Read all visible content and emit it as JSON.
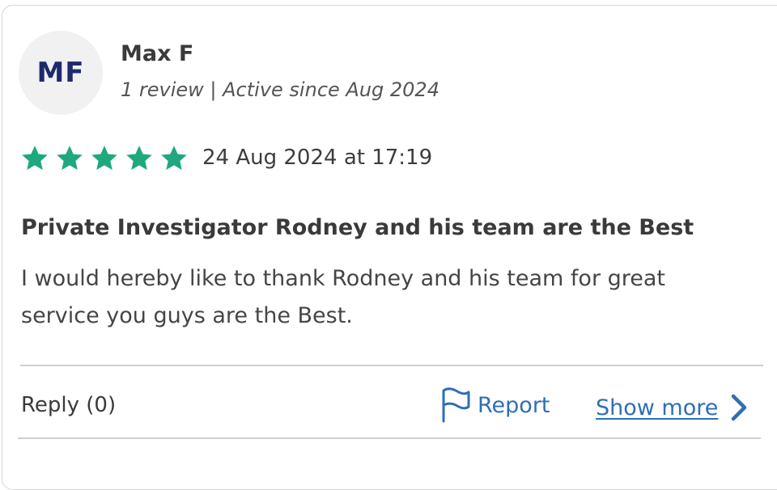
{
  "reviewer": {
    "initials": "MF",
    "name": "Max F",
    "meta": "1 review | Active since Aug 2024"
  },
  "rating": {
    "stars": 5,
    "max": 5,
    "color": "#1fa880"
  },
  "review": {
    "date": "24 Aug 2024 at 17:19",
    "title": "Private Investigator Rodney and his team are the Best",
    "body": "I would hereby like to thank Rodney and his team for great service you guys are the Best."
  },
  "actions": {
    "reply_label": "Reply (0)",
    "report_label": "Report",
    "report_icon": "flag-icon",
    "show_more_label": "Show more",
    "show_more_icon": "chevron-right-icon",
    "link_color": "#2e6fb5"
  }
}
